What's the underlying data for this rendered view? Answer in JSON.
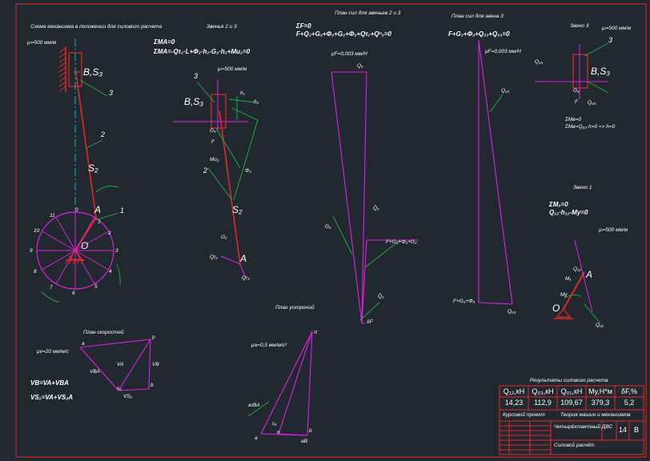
{
  "colors": {
    "background": "#212830",
    "magenta": "#e020e0",
    "red": "#e02828",
    "green": "#20b040",
    "cyan": "#00c8d0",
    "white": "#ffffff"
  },
  "headings": {
    "mechanism": "Схема механизма в положении для силового расчета",
    "links_2_3": "Звенья 2 и 3",
    "force_plan_2_3": "План сил для звеньев 2 и 3",
    "force_plan_3": "План сил для звена 3",
    "link_3": "Звено 3",
    "link_1": "Звено 1",
    "acceleration_plan": "План ускорений",
    "velocity_plan": "План скоростей"
  },
  "scales": {
    "mechanism": "μₗ=500 мм/м",
    "links_2_3": "μₗ=500 мм/м",
    "forces_2_3": "μF=0,003 мм/Н",
    "forces_3": "μF=0,003 мм/Н",
    "link_3": "μₗ=500 мм/м",
    "link_1": "μₗ=500 мм/м",
    "acceleration": "μa=0,5 мм/м/с²",
    "velocity": "μv=20 мм/м/с"
  },
  "equations": {
    "links_2_3_a": "ΣMA=0",
    "links_2_3_b": "ΣMA=-Qτ₂·L+Φ₂·h₁-G₂·h₂+Mи₂=0",
    "forces_2_3_a": "ΣF=0",
    "forces_2_3_b": "F+Q₃+G₃+Φ₃+G₂+Φ₂+Qτ₂+Qⁿ₂=0",
    "forces_3": "F+G₃+Φ₃+Q₂₃+Q₀₃=0",
    "link_3_a": "ΣMв=0",
    "link_3_b": "ΣMв=Q₀₃·h=0 => h=0",
    "link_1_a": "ΣM₀=0",
    "link_1_b": "Q₁₂·h₁₂-Mу=0",
    "velocity_a": "VB=VA+VBA",
    "velocity_b": "VS₂=VA+VS₂A"
  },
  "mechanism_labels": {
    "slider": "B,S₃",
    "crank_end": "A",
    "center": "O",
    "link_1": "1",
    "link_2": "2",
    "link_3": "3",
    "cg_2": "S₂",
    "positions": [
      "0",
      "1",
      "2",
      "3",
      "4",
      "5",
      "6",
      "7",
      "8",
      "9",
      "10",
      "11"
    ]
  },
  "links23_labels": {
    "slider": "B,S₃",
    "link_3": "3",
    "link_2": "2",
    "cg_2": "S₂",
    "point_a": "A",
    "force_f": "F",
    "force_phi2": "Φ₂",
    "force_g3": "G₃",
    "force_g2": "G₂",
    "force_qt": "Qτ₂",
    "force_qn": "Qⁿ₂",
    "moment": "Mи₂",
    "h1": "h₁",
    "h2": "h₂"
  },
  "force_plan_23_labels": {
    "top": "Q₃",
    "mid": "Q̄₃",
    "left": "G₃",
    "resultant": "F+G₃+Φ₃+G₂",
    "low": "Q̄₂",
    "bottom": "δF"
  },
  "force_plan_3_labels": {
    "top_right": "Q₂₃",
    "bottom_left": "F+G₃+Φ₃",
    "bottom_right": "Q₀₃"
  },
  "link3_labels": {
    "slider": "B,S₃",
    "num": "3",
    "q23": "Q₂₃",
    "q03": "Q₀₃",
    "f": "F",
    "g3": "G₃"
  },
  "link1_labels": {
    "a": "A",
    "o": "O",
    "q12": "Q₁₂",
    "m": "M₁",
    "mu": "Mу",
    "q01": "Q₀₁"
  },
  "accel_labels": {
    "pole": "π",
    "b": "b",
    "n": "n",
    "a": "a",
    "s2": "s₂",
    "ab_tau": "aτBA",
    "ab": "aB"
  },
  "velocity_labels": {
    "p": "p",
    "a": "a",
    "b": "b",
    "s2": "s₂",
    "va": "VA",
    "vb": "VB",
    "vba": "VBA",
    "vs2": "VS₂"
  },
  "results": {
    "title": "Результаты силового расчета",
    "headers": [
      "Q₁₂,кН",
      "Q₀₃,кН",
      "Q₀₁,кН",
      "Mу,Н*м",
      "δF,%"
    ],
    "values": [
      "14,23",
      "112,9",
      "109,67",
      "379,3",
      "5,2"
    ]
  },
  "title_block": {
    "project": "Курсовой проект",
    "subject": "Теория машин и механизмов",
    "item": "Четырёхтактный ДВС",
    "sheet_number": "14",
    "letter": "В",
    "sheet_title": "Силовой расчёт"
  }
}
